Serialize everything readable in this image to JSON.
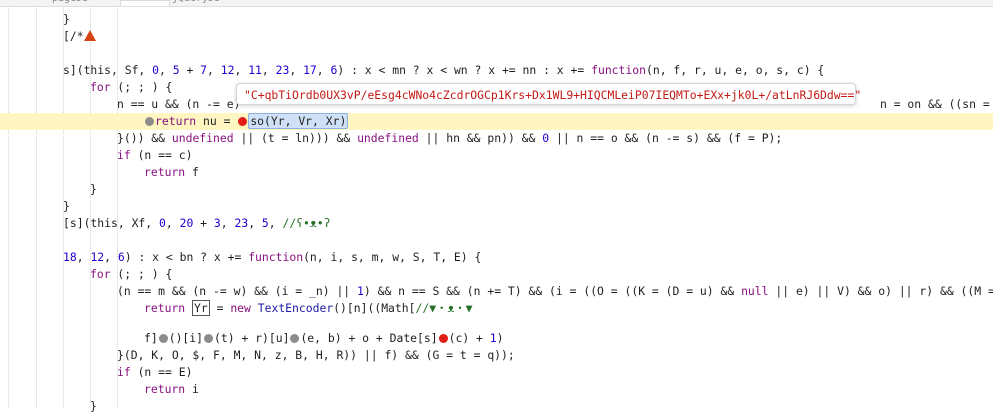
{
  "tabs": [
    "pageJs",
    "",
    "jQueryJs"
  ],
  "tooltip": {
    "value": "\"C+qbTiOrdb0UX3vP/eEsg4cWNo4cZcdrOGCp1Krs+Dx1WL9+HIQCMLeiP07IEQMTo+EXx+jk0L+/atLnRJ6Ddw==\""
  },
  "code": {
    "l1": "}",
    "l2": "[/*",
    "l3a": "s](this, Sf, ",
    "l3b": "0",
    "l3c": ", ",
    "l3d": "5",
    "l3e": " + ",
    "l3f": "7",
    "l3g": ", ",
    "l3h": "12",
    "l3i": ", ",
    "l3j": "11",
    "l3k": ", ",
    "l3l": "23",
    "l3m": ", ",
    "l3n": "17",
    "l3o": ", ",
    "l3p": "6",
    "l3q": ") : x < mn ? x < wn ? x += nn : x += ",
    "l3r": "function",
    "l3s": "(n, f, r, u, e, o, s, c) {",
    "l4a": "for",
    "l4b": " (; ; ) {",
    "l5a": "n == u && (n -= e)",
    "l5b": "n = on && ((sn = A) &",
    "l6a": "return",
    "l6b": " nu = ",
    "l6c": "so(Yr, Vr, Xr)",
    "l7a": "}()) && ",
    "l7b": "undefined",
    "l7c": " || (t = ln))) && ",
    "l7d": "undefined",
    "l7e": " || hn && pn)) && ",
    "l7f": "0",
    "l7g": " || n == o && (n -= s) && (f = P);",
    "l8a": "if",
    "l8b": " (n == c)",
    "l9a": "return",
    "l9b": " f",
    "l10": "}",
    "l11": "}",
    "l12a": "[s](this, Xf, ",
    "l12b": "0",
    "l12c": ", ",
    "l12d": "20",
    "l12e": " + ",
    "l12f": "3",
    "l12g": ", ",
    "l12h": "23",
    "l12i": ", ",
    "l12j": "5",
    "l12k": ", ",
    "l12l": "//ʕ•ᴥ•ʔ",
    "l13a": "18",
    "l13b": ", ",
    "l13c": "12",
    "l13d": ", ",
    "l13e": "6",
    "l13f": ") : x < bn ? x += ",
    "l13g": "function",
    "l13h": "(n, i, s, m, w, S, T, E) {",
    "l14a": "for",
    "l14b": " (; ; ) {",
    "l15a": "(n == m && (n -= w) && (i = _n) || ",
    "l15b": "1",
    "l15c": ") && n == S && (n += T) && (i = ((O = ((K = (D = u) && ",
    "l15d": "null",
    "l15e": " || e) || V) && o) || r) && ((M = ((F",
    "l16a": "return",
    "l16b": " ",
    "l16c": "Yr",
    "l16d": " = ",
    "l16e": "new",
    "l16f": " ",
    "l16g": "TextEncoder",
    "l16h": "()[n]((Math[",
    "l16i": "//▼・ᴥ・▼",
    "l17a": "f]",
    "l17b": "()[i]",
    "l17c": "(t) + r)[u]",
    "l17d": "(e, b) + o + Date[s]",
    "l17e": "(c) + ",
    "l17f": "1",
    "l17g": ")",
    "l18": "}(D, K, O, $, F, M, N, z, B, H, R)) || f) && (G = t = q));",
    "l19a": "if",
    "l19b": " (n == E)",
    "l20a": "return",
    "l20b": " i",
    "l21": "}"
  },
  "colors": {
    "highlight_line": "#fff6c2",
    "breakpoint_active": "#e21d15",
    "breakpoint_inactive": "#8c8c8c",
    "string": "#c41a16",
    "keyword": "#881280",
    "number": "#1c00cf"
  },
  "icons": [
    "warning-triangle-icon",
    "breakpoint-icon",
    "inline-breakpoint-icon"
  ]
}
